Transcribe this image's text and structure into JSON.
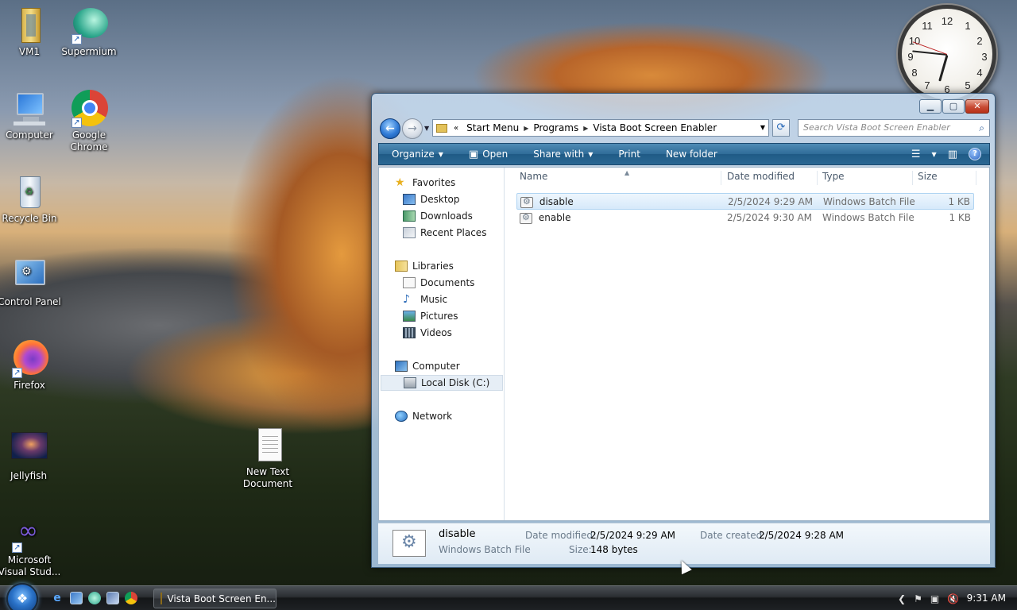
{
  "desktop": {
    "icons": [
      {
        "label": "VM1"
      },
      {
        "label": "Supermium"
      },
      {
        "label": "Computer"
      },
      {
        "label": "Google Chrome"
      },
      {
        "label": "Recycle Bin"
      },
      {
        "label": "Control Panel"
      },
      {
        "label": "Firefox"
      },
      {
        "label": "Jellyfish"
      },
      {
        "label": "New Text Document"
      },
      {
        "label": "Microsoft Visual Stud..."
      }
    ]
  },
  "clock": {
    "numbers": [
      "12",
      "1",
      "2",
      "3",
      "4",
      "5",
      "6",
      "7",
      "8",
      "9",
      "10",
      "11"
    ]
  },
  "window": {
    "address": {
      "crumbs": [
        "Start Menu",
        "Programs",
        "Vista Boot Screen Enabler"
      ]
    },
    "search": {
      "placeholder": "Search Vista Boot Screen Enabler"
    },
    "toolbar": {
      "organize": "Organize",
      "open": "Open",
      "share_with": "Share with",
      "print": "Print",
      "new_folder": "New folder"
    },
    "nav": {
      "favorites": "Favorites",
      "desktop": "Desktop",
      "downloads": "Downloads",
      "recent_places": "Recent Places",
      "libraries": "Libraries",
      "documents": "Documents",
      "music": "Music",
      "pictures": "Pictures",
      "videos": "Videos",
      "computer": "Computer",
      "local_disk": "Local Disk (C:)",
      "network": "Network"
    },
    "columns": {
      "name": "Name",
      "date_modified": "Date modified",
      "type": "Type",
      "size": "Size"
    },
    "files": [
      {
        "name": "disable",
        "date": "2/5/2024 9:29 AM",
        "type": "Windows Batch File",
        "size": "1 KB"
      },
      {
        "name": "enable",
        "date": "2/5/2024 9:30 AM",
        "type": "Windows Batch File",
        "size": "1 KB"
      }
    ],
    "details": {
      "name": "disable",
      "type": "Windows Batch File",
      "date_modified_label": "Date modified:",
      "date_modified": "2/5/2024 9:29 AM",
      "date_created_label": "Date created:",
      "date_created": "2/5/2024 9:28 AM",
      "size_label": "Size:",
      "size": "148 bytes"
    }
  },
  "taskbar": {
    "task_label": "Vista Boot Screen En...",
    "time": "9:31 AM"
  },
  "colors": {
    "toolbar": "#2f6c98",
    "selection": "#d6e9fa",
    "accent": "#2f7ad6"
  }
}
